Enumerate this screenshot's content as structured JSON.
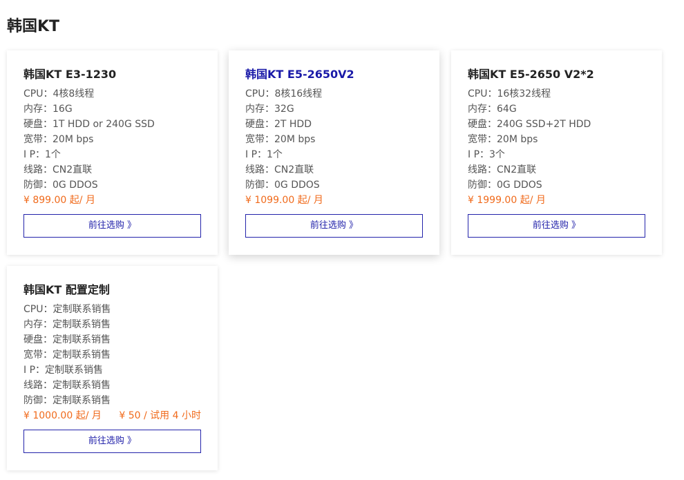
{
  "page": {
    "title": "韩国KT"
  },
  "cards": [
    {
      "title": "韩国KT E3-1230",
      "specs": [
        "CPU：4核8线程",
        "内存：16G",
        "硬盘：1T HDD or 240G SSD",
        "宽带：20M bps",
        "I P：1个",
        "线路：CN2直联",
        "防御：0G DDOS"
      ],
      "price": "¥ 899.00 起/ 月",
      "trial": "",
      "button": "前往选购 》"
    },
    {
      "title": "韩国KT E5-2650V2",
      "specs": [
        "CPU：8核16线程",
        "内存：32G",
        "硬盘：2T HDD",
        "宽带：20M bps",
        "I P：1个",
        "线路：CN2直联",
        "防御：0G DDOS"
      ],
      "price": "¥ 1099.00 起/ 月",
      "trial": "",
      "button": "前往选购 》"
    },
    {
      "title": "韩国KT E5-2650 V2*2",
      "specs": [
        "CPU：16核32线程",
        "内存：64G",
        "硬盘：240G SSD+2T HDD",
        "宽带：20M bps",
        "I P：3个",
        "线路：CN2直联",
        "防御：0G DDOS"
      ],
      "price": "¥ 1999.00 起/ 月",
      "trial": "",
      "button": "前往选购 》"
    },
    {
      "title": "韩国KT 配置定制",
      "specs": [
        "CPU：定制联系销售",
        "内存：定制联系销售",
        "硬盘：定制联系销售",
        "宽带：定制联系销售",
        "I P：定制联系销售",
        "线路：定制联系销售",
        "防御：定制联系销售"
      ],
      "price": "¥ 1000.00 起/ 月",
      "trial": "¥ 50 / 试用 4 小时",
      "button": "前往选购 》"
    }
  ],
  "colors": {
    "accent": "#2222aa",
    "price": "#f06a1b",
    "hover_title": "#1a1aa8"
  }
}
